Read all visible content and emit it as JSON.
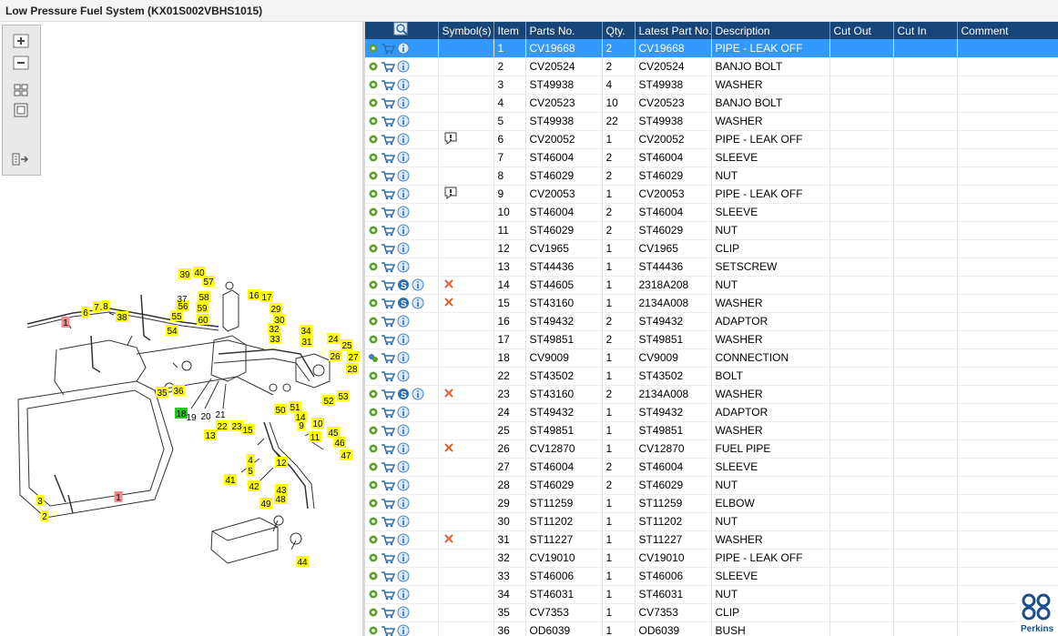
{
  "window": {
    "title": "Low Pressure Fuel System (KX01S002VBHS1015)"
  },
  "toolbar": {
    "buttons": [
      "zoom-in-icon",
      "zoom-out-icon",
      "fit-icon",
      "actual-size-icon",
      "export-icon"
    ]
  },
  "diagram": {
    "callouts": [
      {
        "t": "1",
        "hl": "red"
      },
      {
        "t": "1",
        "hl": "red"
      },
      {
        "t": "2",
        "hl": "yellow"
      },
      {
        "t": "3",
        "hl": "yellow"
      },
      {
        "t": "4",
        "hl": "yellow"
      },
      {
        "t": "5",
        "hl": "yellow"
      },
      {
        "t": "6",
        "hl": "yellow"
      },
      {
        "t": "7",
        "hl": "yellow"
      },
      {
        "t": "8",
        "hl": "yellow"
      },
      {
        "t": "9",
        "hl": "yellow"
      },
      {
        "t": "10",
        "hl": "yellow"
      },
      {
        "t": "11",
        "hl": "yellow"
      },
      {
        "t": "12",
        "hl": "yellow"
      },
      {
        "t": "13",
        "hl": "yellow"
      },
      {
        "t": "14",
        "hl": "yellow"
      },
      {
        "t": "15",
        "hl": "yellow"
      },
      {
        "t": "16",
        "hl": "yellow"
      },
      {
        "t": "17",
        "hl": "yellow"
      },
      {
        "t": "18",
        "hl": "green"
      },
      {
        "t": "19",
        "hl": "none"
      },
      {
        "t": "20",
        "hl": "none"
      },
      {
        "t": "21",
        "hl": "none"
      },
      {
        "t": "22",
        "hl": "yellow"
      },
      {
        "t": "23",
        "hl": "yellow"
      },
      {
        "t": "24",
        "hl": "yellow"
      },
      {
        "t": "25",
        "hl": "yellow"
      },
      {
        "t": "26",
        "hl": "yellow"
      },
      {
        "t": "27",
        "hl": "yellow"
      },
      {
        "t": "28",
        "hl": "yellow"
      },
      {
        "t": "29",
        "hl": "yellow"
      },
      {
        "t": "30",
        "hl": "yellow"
      },
      {
        "t": "31",
        "hl": "yellow"
      },
      {
        "t": "32",
        "hl": "yellow"
      },
      {
        "t": "33",
        "hl": "yellow"
      },
      {
        "t": "34",
        "hl": "yellow"
      },
      {
        "t": "35",
        "hl": "yellow"
      },
      {
        "t": "36",
        "hl": "yellow"
      },
      {
        "t": "38",
        "hl": "yellow"
      },
      {
        "t": "39",
        "hl": "yellow"
      },
      {
        "t": "40",
        "hl": "yellow"
      },
      {
        "t": "41",
        "hl": "yellow"
      },
      {
        "t": "42",
        "hl": "yellow"
      },
      {
        "t": "43",
        "hl": "yellow"
      },
      {
        "t": "44",
        "hl": "yellow"
      },
      {
        "t": "45",
        "hl": "yellow"
      },
      {
        "t": "46",
        "hl": "yellow"
      },
      {
        "t": "47",
        "hl": "yellow"
      },
      {
        "t": "48",
        "hl": "yellow"
      },
      {
        "t": "49",
        "hl": "yellow"
      },
      {
        "t": "50",
        "hl": "yellow"
      },
      {
        "t": "51",
        "hl": "yellow"
      },
      {
        "t": "52",
        "hl": "yellow"
      },
      {
        "t": "53",
        "hl": "yellow"
      },
      {
        "t": "54",
        "hl": "yellow"
      },
      {
        "t": "55",
        "hl": "yellow"
      },
      {
        "t": "56",
        "hl": "yellow"
      },
      {
        "t": "57",
        "hl": "yellow"
      },
      {
        "t": "58",
        "hl": "yellow"
      },
      {
        "t": "59",
        "hl": "yellow"
      },
      {
        "t": "60",
        "hl": "yellow"
      },
      {
        "t": "37",
        "hl": "none"
      }
    ]
  },
  "table": {
    "headers": [
      "",
      "Symbol(s)",
      "Item",
      "Parts No.",
      "Qty.",
      "Latest Part No.",
      "Description",
      "Cut Out",
      "Cut In",
      "Comment"
    ],
    "rows": [
      {
        "item": "1",
        "part": "CV19668",
        "qty": "2",
        "latest": "CV19668",
        "desc": "PIPE - LEAK OFF",
        "sym": "",
        "s": false,
        "selected": true
      },
      {
        "item": "2",
        "part": "CV20524",
        "qty": "2",
        "latest": "CV20524",
        "desc": "BANJO BOLT",
        "sym": "",
        "s": false
      },
      {
        "item": "3",
        "part": "ST49938",
        "qty": "4",
        "latest": "ST49938",
        "desc": "WASHER",
        "sym": "",
        "s": false
      },
      {
        "item": "4",
        "part": "CV20523",
        "qty": "10",
        "latest": "CV20523",
        "desc": "BANJO BOLT",
        "sym": "",
        "s": false
      },
      {
        "item": "5",
        "part": "ST49938",
        "qty": "22",
        "latest": "ST49938",
        "desc": "WASHER",
        "sym": "",
        "s": false
      },
      {
        "item": "6",
        "part": "CV20052",
        "qty": "1",
        "latest": "CV20052",
        "desc": "PIPE - LEAK OFF",
        "sym": "note",
        "s": false
      },
      {
        "item": "7",
        "part": "ST46004",
        "qty": "2",
        "latest": "ST46004",
        "desc": "SLEEVE",
        "sym": "",
        "s": false
      },
      {
        "item": "8",
        "part": "ST46029",
        "qty": "2",
        "latest": "ST46029",
        "desc": "NUT",
        "sym": "",
        "s": false
      },
      {
        "item": "9",
        "part": "CV20053",
        "qty": "1",
        "latest": "CV20053",
        "desc": "PIPE - LEAK OFF",
        "sym": "note",
        "s": false
      },
      {
        "item": "10",
        "part": "ST46004",
        "qty": "2",
        "latest": "ST46004",
        "desc": "SLEEVE",
        "sym": "",
        "s": false
      },
      {
        "item": "11",
        "part": "ST46029",
        "qty": "2",
        "latest": "ST46029",
        "desc": "NUT",
        "sym": "",
        "s": false
      },
      {
        "item": "12",
        "part": "CV1965",
        "qty": "1",
        "latest": "CV1965",
        "desc": "CLIP",
        "sym": "",
        "s": false
      },
      {
        "item": "13",
        "part": "ST44436",
        "qty": "1",
        "latest": "ST44436",
        "desc": "SETSCREW",
        "sym": "",
        "s": false
      },
      {
        "item": "14",
        "part": "ST44605",
        "qty": "1",
        "latest": "2318A208",
        "desc": "NUT",
        "sym": "x",
        "s": true
      },
      {
        "item": "15",
        "part": "ST43160",
        "qty": "1",
        "latest": "2134A008",
        "desc": "WASHER",
        "sym": "x",
        "s": true
      },
      {
        "item": "16",
        "part": "ST49432",
        "qty": "2",
        "latest": "ST49432",
        "desc": "ADAPTOR",
        "sym": "",
        "s": false
      },
      {
        "item": "17",
        "part": "ST49851",
        "qty": "2",
        "latest": "ST49851",
        "desc": "WASHER",
        "sym": "",
        "s": false
      },
      {
        "item": "18",
        "part": "CV9009",
        "qty": "1",
        "latest": "CV9009",
        "desc": "CONNECTION",
        "sym": "",
        "s": false,
        "gears": true
      },
      {
        "item": "22",
        "part": "ST43502",
        "qty": "1",
        "latest": "ST43502",
        "desc": "BOLT",
        "sym": "",
        "s": false
      },
      {
        "item": "23",
        "part": "ST43160",
        "qty": "2",
        "latest": "2134A008",
        "desc": "WASHER",
        "sym": "x",
        "s": true
      },
      {
        "item": "24",
        "part": "ST49432",
        "qty": "1",
        "latest": "ST49432",
        "desc": "ADAPTOR",
        "sym": "",
        "s": false
      },
      {
        "item": "25",
        "part": "ST49851",
        "qty": "1",
        "latest": "ST49851",
        "desc": "WASHER",
        "sym": "",
        "s": false
      },
      {
        "item": "26",
        "part": "CV12870",
        "qty": "1",
        "latest": "CV12870",
        "desc": "FUEL PIPE",
        "sym": "x",
        "s": false
      },
      {
        "item": "27",
        "part": "ST46004",
        "qty": "2",
        "latest": "ST46004",
        "desc": "SLEEVE",
        "sym": "",
        "s": false
      },
      {
        "item": "28",
        "part": "ST46029",
        "qty": "2",
        "latest": "ST46029",
        "desc": "NUT",
        "sym": "",
        "s": false
      },
      {
        "item": "29",
        "part": "ST11259",
        "qty": "1",
        "latest": "ST11259",
        "desc": "ELBOW",
        "sym": "",
        "s": false
      },
      {
        "item": "30",
        "part": "ST11202",
        "qty": "1",
        "latest": "ST11202",
        "desc": "NUT",
        "sym": "",
        "s": false
      },
      {
        "item": "31",
        "part": "ST11227",
        "qty": "1",
        "latest": "ST11227",
        "desc": "WASHER",
        "sym": "x",
        "s": false
      },
      {
        "item": "32",
        "part": "CV19010",
        "qty": "1",
        "latest": "CV19010",
        "desc": "PIPE - LEAK OFF",
        "sym": "",
        "s": false
      },
      {
        "item": "33",
        "part": "ST46006",
        "qty": "1",
        "latest": "ST46006",
        "desc": "SLEEVE",
        "sym": "",
        "s": false
      },
      {
        "item": "34",
        "part": "ST46031",
        "qty": "1",
        "latest": "ST46031",
        "desc": "NUT",
        "sym": "",
        "s": false
      },
      {
        "item": "35",
        "part": "CV7353",
        "qty": "1",
        "latest": "CV7353",
        "desc": "CLIP",
        "sym": "",
        "s": false
      },
      {
        "item": "36",
        "part": "OD6039",
        "qty": "1",
        "latest": "OD6039",
        "desc": "BUSH",
        "sym": "",
        "s": false
      }
    ]
  },
  "brand": {
    "name": "Perkins",
    "color": "#1b4f8a"
  },
  "colors": {
    "header": "#17457a",
    "selected": "#3399ff",
    "callout_yellow": "#ffff00",
    "callout_red": "#f08a8a",
    "callout_green": "#22cc22"
  }
}
